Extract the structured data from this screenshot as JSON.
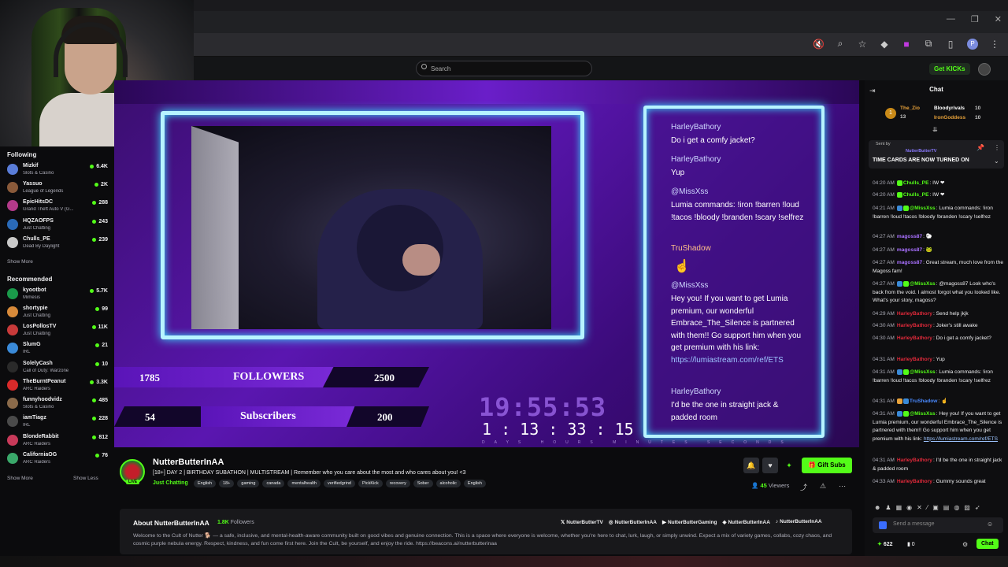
{
  "browser": {
    "window_controls": [
      "—",
      "❐",
      "✕"
    ],
    "icons": [
      "mute-icon",
      "zoom-icon",
      "star-icon",
      "extension-icon",
      "extension2-icon",
      "puzzle-icon",
      "panel-icon",
      "profile-icon",
      "menu-icon"
    ],
    "profile_letter": "P"
  },
  "header": {
    "search_placeholder": "Search",
    "get_kicks": "Get KICKs"
  },
  "sidebar": {
    "following_heading": "Following",
    "following": [
      {
        "name": "Mizkif",
        "game": "Slots & Casino",
        "viewers": "6.4K",
        "color": "#5a7dd8"
      },
      {
        "name": "Yassuo",
        "game": "League of Legends",
        "viewers": "2K",
        "color": "#8a5a3a"
      },
      {
        "name": "EpicHitsDC",
        "game": "Grand Theft Auto V (G...",
        "viewers": "288",
        "color": "#b33a8a"
      },
      {
        "name": "HQZAOFPS",
        "game": "Just Chatting",
        "viewers": "243",
        "color": "#2a6ab8"
      },
      {
        "name": "Chulls_PE",
        "game": "Dead By Daylight",
        "viewers": "239",
        "color": "#c9c9c9"
      }
    ],
    "show_more_1": "Show More",
    "recommended_heading": "Recommended",
    "recommended": [
      {
        "name": "kyootbot",
        "game": "Mimesis",
        "viewers": "5.7K",
        "color": "#1a9a4a"
      },
      {
        "name": "shortypie",
        "game": "Just Chatting",
        "viewers": "99",
        "color": "#d88a3a"
      },
      {
        "name": "LosPollosTV",
        "game": "Just Chatting",
        "viewers": "11K",
        "color": "#c83a3a"
      },
      {
        "name": "SlumG",
        "game": "IRL",
        "viewers": "21",
        "color": "#3a8ad8"
      },
      {
        "name": "SolelyCash",
        "game": "Call of Duty: Warzone",
        "viewers": "10",
        "color": "#2a2a2a"
      },
      {
        "name": "TheBurntPeanut",
        "game": "ARC Raiders",
        "viewers": "3.3K",
        "color": "#d82a2a"
      },
      {
        "name": "funnyhoodvidz",
        "game": "Slots & Casino",
        "viewers": "485",
        "color": "#8a6a4a"
      },
      {
        "name": "iamTiagz",
        "game": "IRL",
        "viewers": "228",
        "color": "#4a4a4a"
      },
      {
        "name": "BlondeRabbit",
        "game": "ARC Raiders",
        "viewers": "812",
        "color": "#c83a5a"
      },
      {
        "name": "CaliforniaOG",
        "game": "ARC Raiders",
        "viewers": "76",
        "color": "#3aa86a"
      }
    ],
    "show_more_2": "Show More",
    "show_less": "Show Less"
  },
  "stream_overlay": {
    "followers_current": "1785",
    "followers_label": "FOLLOWERS",
    "followers_goal": "2500",
    "subs_current": "54",
    "subs_label": "Subscribers",
    "subs_goal": "200",
    "timer_big": "19:55:53",
    "timer_small": "1 : 13 : 33 : 15",
    "timer_labels": "DAYS HOURS MINUTES SECONDS",
    "chat": [
      {
        "user": "HarleyBathory",
        "msg": "Do i get a comfy jacket?"
      },
      {
        "user": "HarleyBathory",
        "msg": "Yup"
      },
      {
        "user": "@MissXss",
        "msg": "Lumia commands: !iron !barren !loud !tacos !bloody !branden !scary !selfrez"
      },
      {
        "user": "TruShadow",
        "msg": ""
      },
      {
        "user": "@MissXss",
        "msg": "Hey you! If you want to get Lumia premium, our wonderful Embrace_The_Silence is partnered with them!! Go support him when you get premium with his link: ",
        "link": "https://lumiastream.com/ref/ETS"
      },
      {
        "user": "HarleyBathory",
        "msg": "I'd be the one in straight jack & padded room"
      }
    ]
  },
  "channel": {
    "name": "NutterButterInAA",
    "live": "LIVE",
    "title": "[18+] DAY 2 | BIRTHDAY SUBATHON | MULTISTREAM | Remember who you care about the most and who cares about you! <3",
    "category": "Just Chatting",
    "tags": [
      "English",
      "18+",
      "gaming",
      "canada",
      "mentalhealth",
      "verifiedgrind",
      "PickKick",
      "recovery",
      "Sober",
      "alcoholic",
      "English"
    ],
    "gift_subs": "Gift Subs",
    "viewers_count": "45",
    "viewers_label": "Viewers"
  },
  "about": {
    "title": "About NutterButterInAA",
    "followers_count": "1.8K",
    "followers_label": "Followers",
    "socials": [
      "NutterButterTV",
      "NutterButterInAA",
      "NutterButterGaming",
      "NutterButterInAA",
      "NutterButterInAA"
    ],
    "description": "Welcome to the Cult of Nutter 🐕 — a safe, inclusive, and mental-health-aware community built on good vibes and genuine connection. This is a space where everyone is welcome, whether you're here to chat, lurk, laugh, or simply unwind. Expect a mix of variety games, collabs, cozy chaos, and cosmic purple nebula energy. Respect, kindness, and fun come first here. Join the Cult, be yourself, and enjoy the ride. https://beacons.ai/nutterbutterinaa"
  },
  "chat": {
    "title": "Chat",
    "top_gifters": [
      {
        "name": "The_Zio",
        "count": "13"
      },
      {
        "name": "Bloodyrivals",
        "count": "10"
      },
      {
        "name": "IronGoddess",
        "count": "10"
      }
    ],
    "gifter_rank": "1",
    "pinned_sent_by": "Sent by",
    "pinned_user": "NutterButterTV",
    "pinned_msg": "TIME CARDS ARE NOW TURNED ON",
    "messages": [
      {
        "time": "04:20 AM",
        "user": "Chulls_PE",
        "color": "#53fc18",
        "text": "IW ❤"
      },
      {
        "time": "04:20 AM",
        "user": "Chulls_PE",
        "color": "#53fc18",
        "text": "IW ❤"
      },
      {
        "time": "04:21 AM",
        "user": "@MissXss",
        "color": "#53fc18",
        "text": "Lumia commands: !iron !barren !loud !tacos !bloody !branden !scary !selfrez"
      },
      {
        "time": "04:27 AM",
        "user": "magoss87",
        "color": "#a970ff",
        "text": "🐑"
      },
      {
        "time": "04:27 AM",
        "user": "magoss87",
        "color": "#a970ff",
        "text": "🐸"
      },
      {
        "time": "04:27 AM",
        "user": "magoss87",
        "color": "#a970ff",
        "text": "Great stream, much love from the Magoss fam!"
      },
      {
        "time": "04:27 AM",
        "user": "@MissXss",
        "color": "#53fc18",
        "text": "@magoss87 Look who's back from the void. I almost forgot what you looked like. What's your story, magoss?"
      },
      {
        "time": "04:29 AM",
        "user": "HarleyBathory",
        "color": "#e0293a",
        "text": "Send help jkjk"
      },
      {
        "time": "04:30 AM",
        "user": "HarleyBathory",
        "color": "#e0293a",
        "text": "Joker's still awake"
      },
      {
        "time": "04:30 AM",
        "user": "HarleyBathory",
        "color": "#e0293a",
        "text": "Do i get a comfy jacket?"
      },
      {
        "time": "04:31 AM",
        "user": "HarleyBathory",
        "color": "#e0293a",
        "text": "Yup"
      },
      {
        "time": "04:31 AM",
        "user": "@MissXss",
        "color": "#53fc18",
        "text": "Lumia commands: !iron !barren !loud !tacos !bloody !branden !scary !selfrez"
      },
      {
        "time": "04:31 AM",
        "user": "TruShadow",
        "color": "#4a8aff",
        "text": ""
      },
      {
        "time": "04:31 AM",
        "user": "@MissXss",
        "color": "#53fc18",
        "text": "Hey you! If you want to get Lumia premium, our wonderful Embrace_The_Silence is partnered with them!! Go support him when you get premium with his link: ",
        "link": "https://lumiastream.com/ref/ETS"
      },
      {
        "time": "04:31 AM",
        "user": "HarleyBathory",
        "color": "#e0293a",
        "text": "I'd be the one in straight jack & padded room"
      },
      {
        "time": "04:33 AM",
        "user": "HarleyBathory",
        "color": "#e0293a",
        "text": "Gummy sounds great"
      }
    ],
    "input_placeholder": "Send a message",
    "points": "622",
    "points2": "0",
    "send_label": "Chat"
  }
}
